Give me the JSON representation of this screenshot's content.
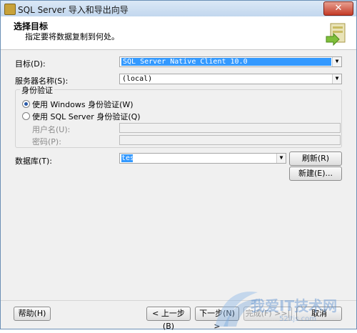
{
  "window": {
    "title": "SQL Server 导入和导出向导",
    "close_glyph": "✕"
  },
  "header": {
    "title": "选择目标",
    "subtitle": "指定要将数据复制到何处。"
  },
  "form": {
    "target_label": "目标(D):",
    "target_value": "SQL Server Native Client 10.0",
    "server_label": "服务器名称(S):",
    "server_value": "(local)",
    "auth_group_label": "身份验证",
    "auth_windows_label": "使用 Windows 身份验证(W)",
    "auth_sql_label": "使用 SQL Server 身份验证(Q)",
    "username_label": "用户名(U):",
    "password_label": "密码(P):",
    "database_label": "数据库(T):",
    "database_value": "test",
    "refresh_label": "刷新(R)",
    "new_label": "新建(E)..."
  },
  "footer": {
    "help_label": "帮助(H)",
    "back_label": "< 上一步(B)",
    "next_label": "下一步(N) >",
    "finish_label": "完成(F) >>|",
    "cancel_label": "取消"
  },
  "watermark": {
    "text": "我爱IT技术网",
    "sub": "52itjs.com"
  },
  "colors": {
    "selection": "#3399ff",
    "title_gradient": "#c2d7ee",
    "close_red": "#c43b28"
  }
}
